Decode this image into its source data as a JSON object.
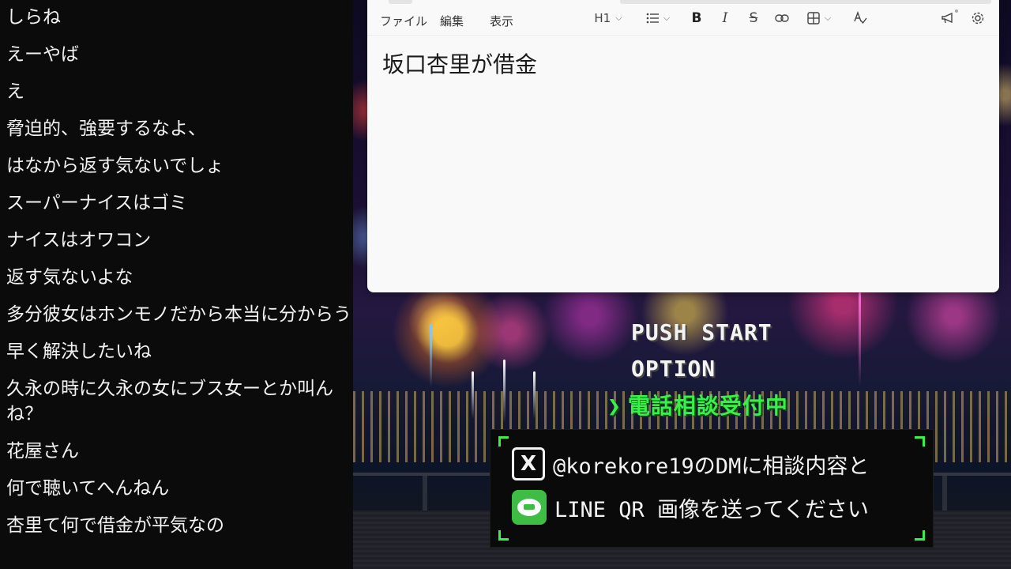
{
  "chat": {
    "messages": [
      "しらね",
      "えーやば",
      "え",
      "脅迫的、強要するなよ、",
      "はなから返す気ないでしょ",
      "スーパーナイスはゴミ",
      "ナイスはオワコン",
      "返す気ないよな",
      "多分彼女はホンモノだから本当に分からう",
      "早く解決したいね",
      "久永の時に久永の女にブス女ーとか叫んね？",
      "花屋さん",
      "何で聴いてへんねん",
      "杏里て何で借金が平気なの"
    ]
  },
  "editor": {
    "menu": [
      "ファイル",
      "編集",
      "表示"
    ],
    "heading_label": "H1",
    "bold_label": "B",
    "italic_label": "I",
    "strike_label": "S",
    "content_heading": "坂口杏里が借金",
    "toolbar_icons": [
      "list-icon",
      "link-icon",
      "table-icon",
      "spellcheck-icon",
      "megaphone-icon",
      "gear-icon"
    ]
  },
  "stream": {
    "push_start": "PUSH START",
    "option": "OPTION",
    "phone_consult": "電話相談受付中",
    "arrow": "❯",
    "x_line": "@korekore19のDMに相談内容と",
    "line_line": "LINE QR 画像を送ってください",
    "x_icon_glyph": "X",
    "colors": {
      "menu_green": "#39f04a",
      "line_green": "#3dbd43"
    }
  }
}
